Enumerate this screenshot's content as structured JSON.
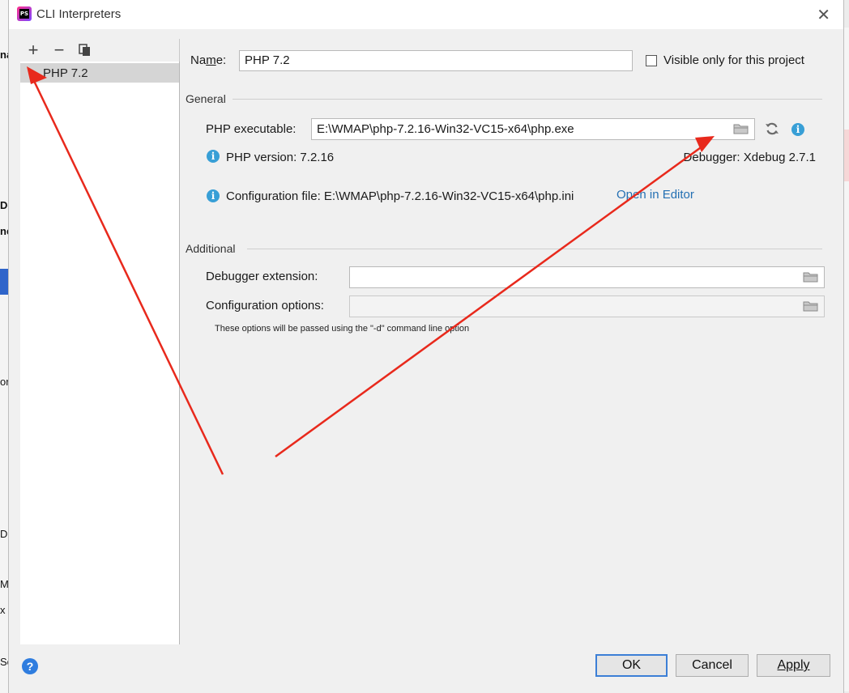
{
  "window": {
    "title": "CLI Interpreters"
  },
  "background_fragments": [
    "na",
    "De",
    "ne",
    "or",
    "D",
    "M",
    "x",
    "Sc"
  ],
  "list": {
    "toolbar": {
      "add": "+",
      "remove": "−"
    },
    "items": [
      "PHP 7.2"
    ]
  },
  "form": {
    "name_label_pre": "Na",
    "name_label_mnemonic": "m",
    "name_label_post": "e:",
    "name_value": "PHP 7.2",
    "visible_only_label": "Visible only for this project",
    "general_section": "General",
    "php_executable_label": "PHP executable:",
    "php_executable_value": "E:\\WMAP\\php-7.2.16-Win32-VC15-x64\\php.exe",
    "php_version": "PHP version: 7.2.16",
    "debugger": "Debugger: Xdebug 2.7.1",
    "config_file": "Configuration file: E:\\WMAP\\php-7.2.16-Win32-VC15-x64\\php.ini",
    "open_in_editor": "Open in Editor",
    "additional_section": "Additional",
    "debugger_extension_label": "Debugger extension:",
    "configuration_options_label": "Configuration options:",
    "options_hint": "These options will be passed using the \"-d\" command line option"
  },
  "buttons": {
    "ok": "OK",
    "cancel": "Cancel",
    "apply": "Apply",
    "help": "?"
  },
  "colors": {
    "accent": "#389fd6",
    "link": "#2470b3",
    "annotation_arrow": "#e8291c",
    "selection": "#d5d5d5"
  }
}
